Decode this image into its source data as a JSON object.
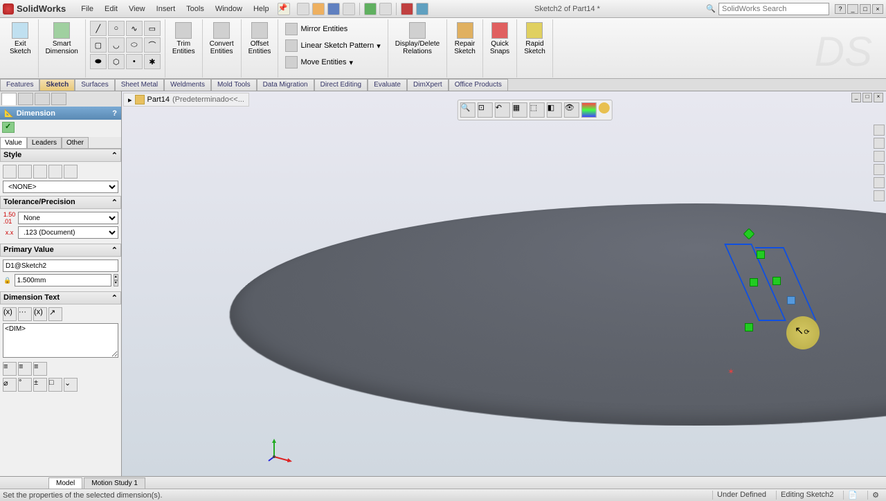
{
  "app": {
    "name": "SolidWorks"
  },
  "menu": [
    "File",
    "Edit",
    "View",
    "Insert",
    "Tools",
    "Window",
    "Help"
  ],
  "doc_title": "Sketch2 of Part14 *",
  "search_placeholder": "SolidWorks Search",
  "ribbon": {
    "exit_sketch": "Exit\nSketch",
    "smart_dimension": "Smart\nDimension",
    "trim_entities": "Trim\nEntities",
    "convert_entities": "Convert\nEntities",
    "offset_entities": "Offset\nEntities",
    "mirror_entities": "Mirror Entities",
    "linear_pattern": "Linear Sketch Pattern",
    "move_entities": "Move Entities",
    "display_relations": "Display/Delete\nRelations",
    "repair_sketch": "Repair\nSketch",
    "quick_snaps": "Quick\nSnaps",
    "rapid_sketch": "Rapid\nSketch"
  },
  "command_tabs": [
    "Features",
    "Sketch",
    "Surfaces",
    "Sheet Metal",
    "Weldments",
    "Mold Tools",
    "Data Migration",
    "Direct Editing",
    "Evaluate",
    "DimXpert",
    "Office Products"
  ],
  "active_cmd_tab": 1,
  "panel": {
    "title": "Dimension",
    "tabs": [
      "Value",
      "Leaders",
      "Other"
    ],
    "active_tab": 0,
    "style_header": "Style",
    "style_value": "<NONE>",
    "tolerance_header": "Tolerance/Precision",
    "tolerance_type": "None",
    "tolerance_precision": ".123 (Document)",
    "primary_header": "Primary Value",
    "primary_name": "D1@Sketch2",
    "primary_value": "1.500mm",
    "dimtext_header": "Dimension Text",
    "dimtext_value": "<DIM>"
  },
  "breadcrumb": {
    "part": "Part14",
    "extra": "(Predeterminado<<..."
  },
  "bottom_tabs": [
    "Model",
    "Motion Study 1"
  ],
  "status": {
    "message": "Set the properties of the selected dimension(s).",
    "under_defined": "Under Defined",
    "editing": "Editing Sketch2"
  }
}
